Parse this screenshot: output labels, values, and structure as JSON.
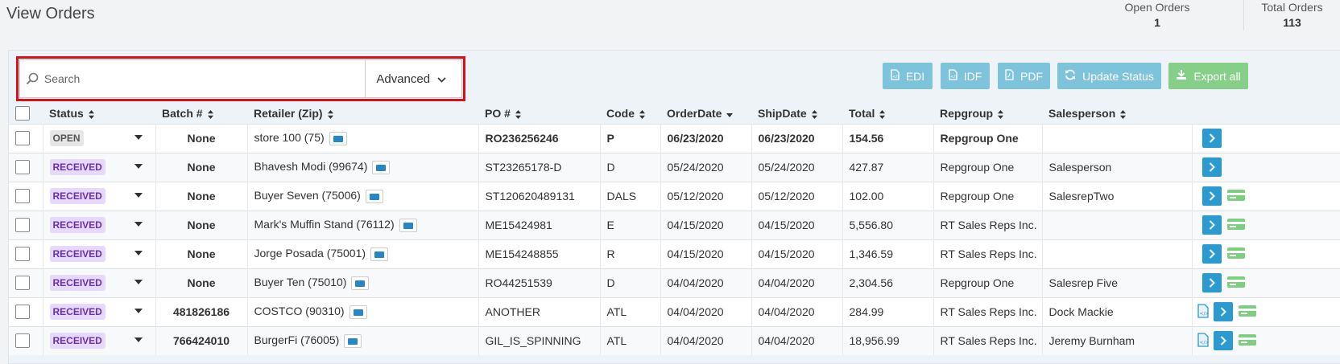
{
  "page": {
    "title": "View Orders"
  },
  "stats": {
    "open_orders_label": "Open Orders",
    "open_orders_value": "1",
    "total_orders_label": "Total Orders",
    "total_orders_value": "113"
  },
  "search": {
    "placeholder": "Search",
    "value": "",
    "advanced_label": "Advanced"
  },
  "toolbar": {
    "edi_label": "EDI",
    "idf_label": "IDF",
    "pdf_label": "PDF",
    "update_status_label": "Update Status",
    "export_all_label": "Export all"
  },
  "table": {
    "columns": [
      "Status",
      "Batch #",
      "Retailer (Zip)",
      "PO #",
      "Code",
      "OrderDate",
      "ShipDate",
      "Total",
      "Repgroup",
      "Salesperson"
    ],
    "rows": [
      {
        "status": "OPEN",
        "batch": "None",
        "retailer": "store 100 (75)",
        "po": "RO236256246",
        "code": "P",
        "order_date": "06/23/2020",
        "ship_date": "06/23/2020",
        "total": "154.56",
        "repgroup": "Repgroup One",
        "salesperson": ""
      },
      {
        "status": "RECEIVED",
        "batch": "None",
        "retailer": "Bhavesh Modi (99674)",
        "po": "ST23265178-D",
        "code": "D",
        "order_date": "05/24/2020",
        "ship_date": "05/24/2020",
        "total": "427.87",
        "repgroup": "Repgroup One",
        "salesperson": "Salesperson"
      },
      {
        "status": "RECEIVED",
        "batch": "None",
        "retailer": "Buyer Seven (75006)",
        "po": "ST120620489131",
        "code": "DALS",
        "order_date": "05/12/2020",
        "ship_date": "05/12/2020",
        "total": "102.00",
        "repgroup": "Repgroup One",
        "salesperson": "SalesrepTwo"
      },
      {
        "status": "RECEIVED",
        "batch": "None",
        "retailer": "Mark's Muffin Stand (76112)",
        "po": "ME15424981",
        "code": "E",
        "order_date": "04/15/2020",
        "ship_date": "04/15/2020",
        "total": "5,556.80",
        "repgroup": "RT Sales Reps Inc.",
        "salesperson": ""
      },
      {
        "status": "RECEIVED",
        "batch": "None",
        "retailer": "Jorge Posada (75001)",
        "po": "ME154248855",
        "code": "R",
        "order_date": "04/15/2020",
        "ship_date": "04/15/2020",
        "total": "1,346.59",
        "repgroup": "RT Sales Reps Inc.",
        "salesperson": ""
      },
      {
        "status": "RECEIVED",
        "batch": "None",
        "retailer": "Buyer Ten (75010)",
        "po": "RO44251539",
        "code": "D",
        "order_date": "04/04/2020",
        "ship_date": "04/04/2020",
        "total": "2,304.56",
        "repgroup": "Repgroup One",
        "salesperson": "Salesrep Five"
      },
      {
        "status": "RECEIVED",
        "batch": "481826186",
        "retailer": "COSTCO (90310)",
        "po": "ANOTHER",
        "code": "ATL",
        "order_date": "04/04/2020",
        "ship_date": "04/04/2020",
        "total": "284.99",
        "repgroup": "RT Sales Reps Inc.",
        "salesperson": "Dock Mackie"
      },
      {
        "status": "RECEIVED",
        "batch": "766424010",
        "retailer": "BurgerFi (76005)",
        "po": "GIL_IS_SPINNING",
        "code": "ATL",
        "order_date": "04/04/2020",
        "ship_date": "04/04/2020",
        "total": "18,956.99",
        "repgroup": "RT Sales Reps Inc.",
        "salesperson": "Jeremy Burnham"
      }
    ]
  },
  "colors": {
    "accent": "#2a9ad1",
    "highlight": "#d9101a",
    "export_green": "#86cf89",
    "received_badge": "#e6d9fb"
  },
  "icons": [
    "search-icon",
    "chevron-down-icon",
    "file-code-icon",
    "file-pdf-icon",
    "refresh-icon",
    "download-icon",
    "sort-icon",
    "caret-down-icon",
    "contact-card-icon",
    "chevron-right-icon",
    "payment-card-icon"
  ]
}
